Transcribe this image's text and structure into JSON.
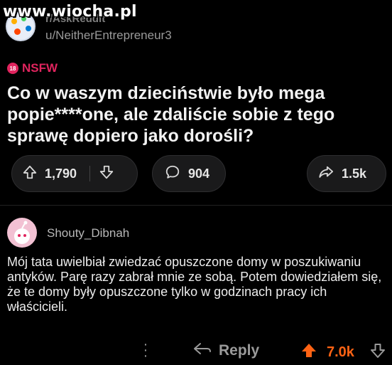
{
  "watermark": "www.wiocha.pl",
  "post": {
    "subreddit": "r/AskReddit",
    "username": "u/NeitherEntrepreneur3",
    "nsfw_label": "NSFW",
    "nsfw_icon_text": "18",
    "title": "Co w waszym dzieciństwie było mega popie****one, ale zdaliście sobie z tego sprawę dopiero jako dorośli?",
    "upvotes": "1,790",
    "comments": "904",
    "shares": "1.5k"
  },
  "comment": {
    "author": "Shouty_Dibnah",
    "body": "Mój tata uwielbiał zwiedzać opuszczone domy w poszukiwaniu antyków. Parę razy zabrał mnie ze sobą. Potem dowiedziałem się, że te domy były opuszczone tylko w godzinach pracy ich właścicieli.",
    "reply_label": "Reply",
    "score": "7.0k",
    "score_color": "#ff6314"
  },
  "icons": {
    "upvote": "upvote-arrow-icon",
    "downvote": "downvote-arrow-icon",
    "comment": "speech-bubble-icon",
    "share": "share-arrow-icon",
    "reply": "reply-arrow-icon",
    "more": "vertical-dots-icon"
  }
}
